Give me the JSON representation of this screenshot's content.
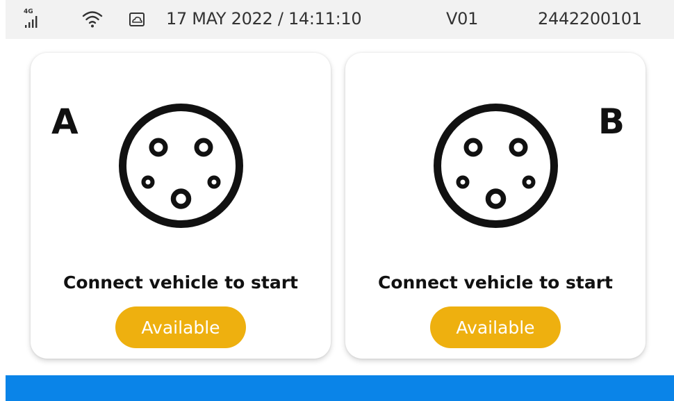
{
  "status_bar": {
    "network_label": "4G",
    "icons": [
      "cellular-signal-icon",
      "wifi-icon",
      "cloud-icon"
    ],
    "datetime": "17 MAY 2022 / 14:11:10",
    "version": "V01",
    "device_id": "2442200101"
  },
  "connectors": [
    {
      "letter": "A",
      "icon": "type2-connector-icon",
      "message": "Connect vehicle to start",
      "status": "Available"
    },
    {
      "letter": "B",
      "icon": "type2-connector-icon",
      "message": "Connect vehicle to start",
      "status": "Available"
    }
  ],
  "colors": {
    "status_bar_bg": "#f2f2f2",
    "available": "#eeb00f",
    "bottom_bar": "#0a84e8"
  }
}
